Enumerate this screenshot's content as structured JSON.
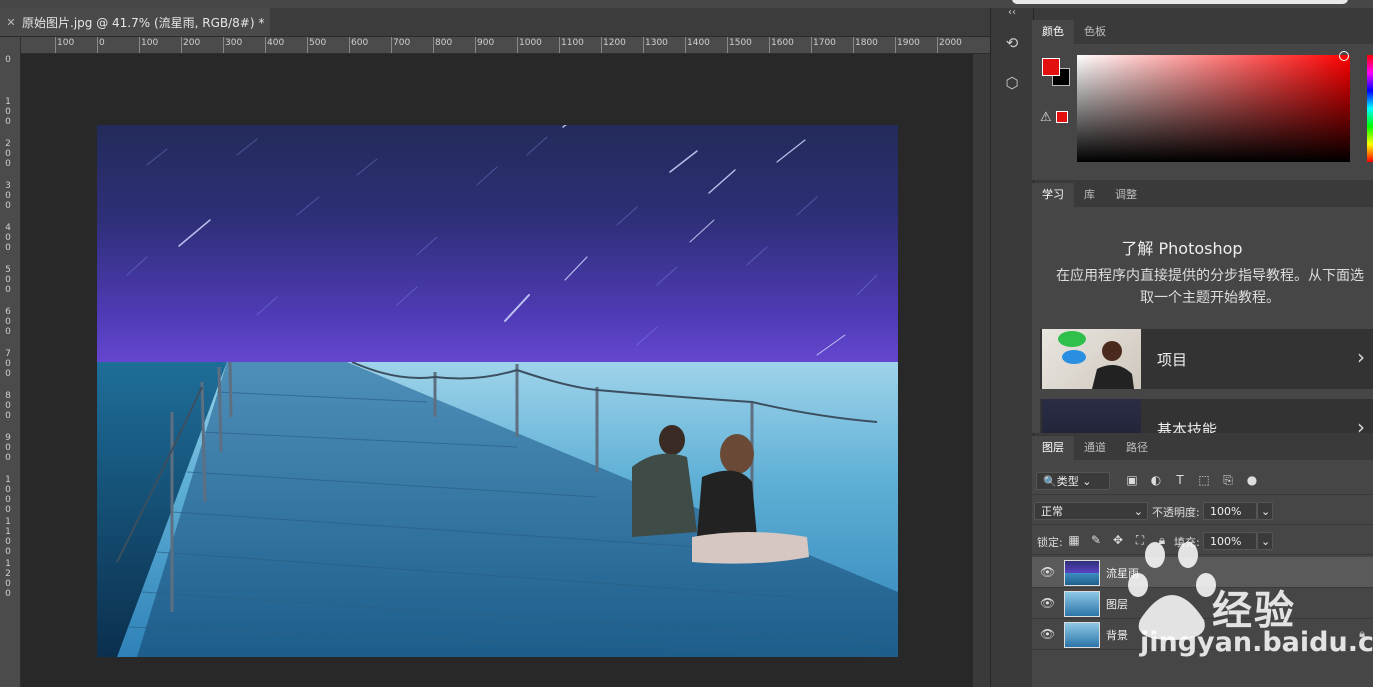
{
  "document": {
    "tab_title": "原始图片.jpg @ 41.7% (流星雨, RGB/8#) *",
    "ruler_top_labels": [
      "100",
      "0",
      "100",
      "200",
      "300",
      "400",
      "500",
      "600",
      "700",
      "800",
      "900",
      "1000",
      "1100",
      "1200",
      "1300",
      "1400",
      "1500",
      "1600",
      "1700",
      "1800",
      "1900",
      "2000"
    ],
    "ruler_left_labels": [
      "0",
      "100",
      "200",
      "300",
      "400",
      "500",
      "600",
      "700",
      "800",
      "900",
      "1000",
      "1100",
      "1200"
    ]
  },
  "color_panel": {
    "tabs": [
      "颜色",
      "色板"
    ],
    "foreground": "#e31010",
    "background": "#000000"
  },
  "learn_panel": {
    "tabs": [
      "学习",
      "库",
      "调整"
    ],
    "title": "了解 Photoshop",
    "description": "在应用程序内直接提供的分步指导教程。从下面选取一个主题开始教程。",
    "cards": [
      {
        "label": "项目"
      },
      {
        "label": "基本技能"
      }
    ]
  },
  "layers_panel": {
    "tabs": [
      "图层",
      "通道",
      "路径"
    ],
    "filter_kind": "类型",
    "blend_mode": "正常",
    "opacity_label": "不透明度:",
    "opacity_value": "100%",
    "lock_label": "锁定:",
    "fill_label": "填充:",
    "fill_value": "100%",
    "layers": [
      {
        "name": "流星雨",
        "selected": true
      },
      {
        "name": "图层",
        "selected": false
      },
      {
        "name": "背景",
        "selected": false,
        "locked": true
      }
    ]
  },
  "watermark": {
    "brand": "经验",
    "logo_text": "Bai du",
    "url": "jingyan.baidu.com"
  }
}
